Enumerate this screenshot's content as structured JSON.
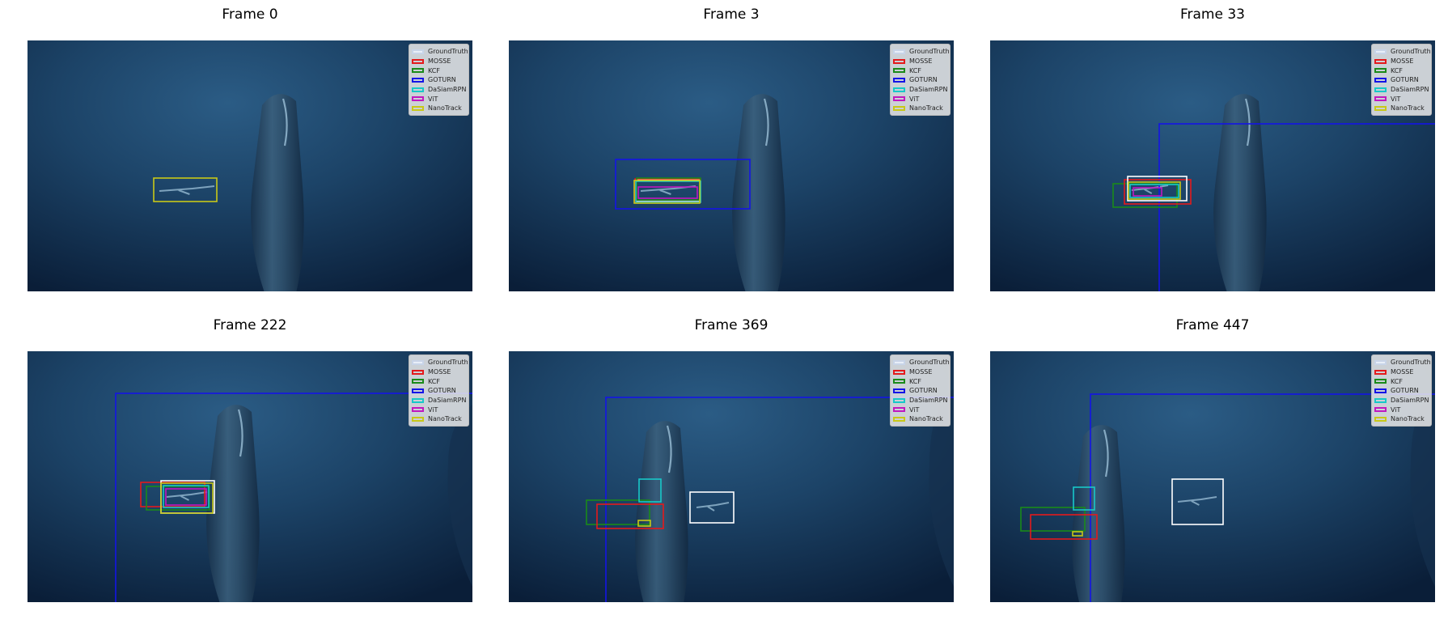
{
  "legend": [
    {
      "label": "GroundTruth",
      "color": "#ffffff"
    },
    {
      "label": "MOSSE",
      "color": "#e41a1c"
    },
    {
      "label": "KCF",
      "color": "#1a8a1a"
    },
    {
      "label": "GOTURN",
      "color": "#1414e6"
    },
    {
      "label": "DaSiamRPN",
      "color": "#18c8c8"
    },
    {
      "label": "ViT",
      "color": "#c018c0"
    },
    {
      "label": "NanoTrack",
      "color": "#c8c818"
    }
  ],
  "frames": [
    {
      "title": "Frame 0"
    },
    {
      "title": "Frame 3"
    },
    {
      "title": "Frame 33"
    },
    {
      "title": "Frame 222"
    },
    {
      "title": "Frame 369"
    },
    {
      "title": "Frame 447"
    }
  ]
}
